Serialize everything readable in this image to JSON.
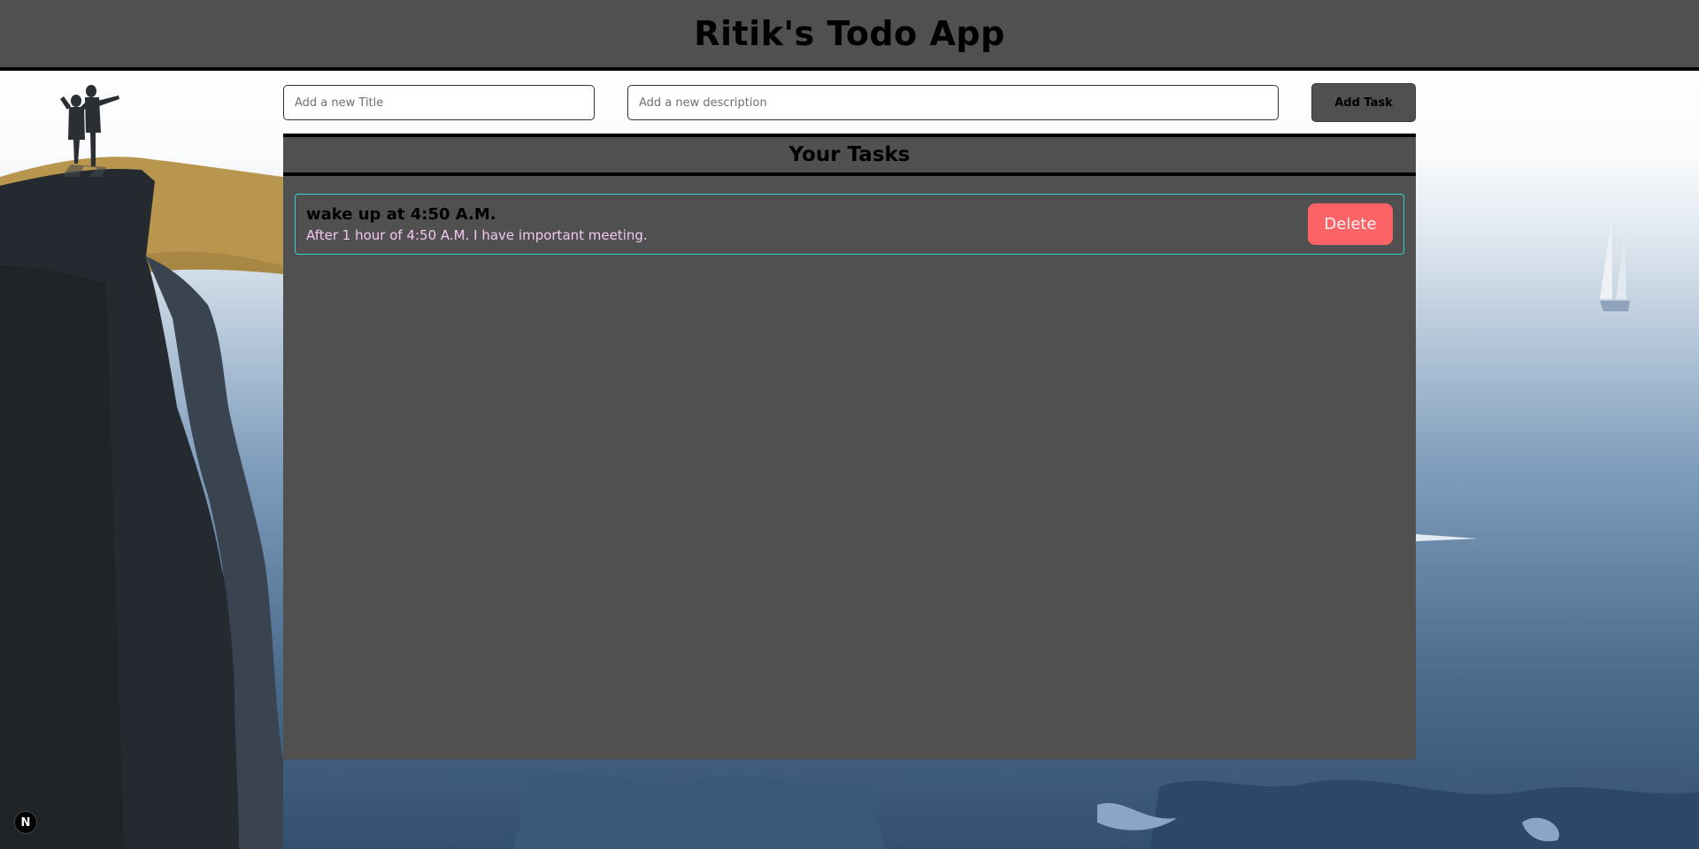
{
  "app": {
    "title": "Ritik's Todo App"
  },
  "form": {
    "title_placeholder": "Add a new Title",
    "title_value": "",
    "description_placeholder": "Add a new description",
    "description_value": "",
    "add_button_label": "Add Task"
  },
  "tasks_panel": {
    "heading": "Your Tasks",
    "tasks": [
      {
        "title": "wake up at 4:50 A.M.",
        "description": "After 1 hour of 4:50 A.M. I have important meeting.",
        "delete_label": "Delete"
      }
    ]
  },
  "dev_badge": {
    "letter": "N"
  },
  "colors": {
    "header_bg": "#505050",
    "panel_bg": "#505050",
    "task_border": "#2fd1cf",
    "task_description": "#f4c6f2",
    "delete_button": "#fc6366"
  }
}
